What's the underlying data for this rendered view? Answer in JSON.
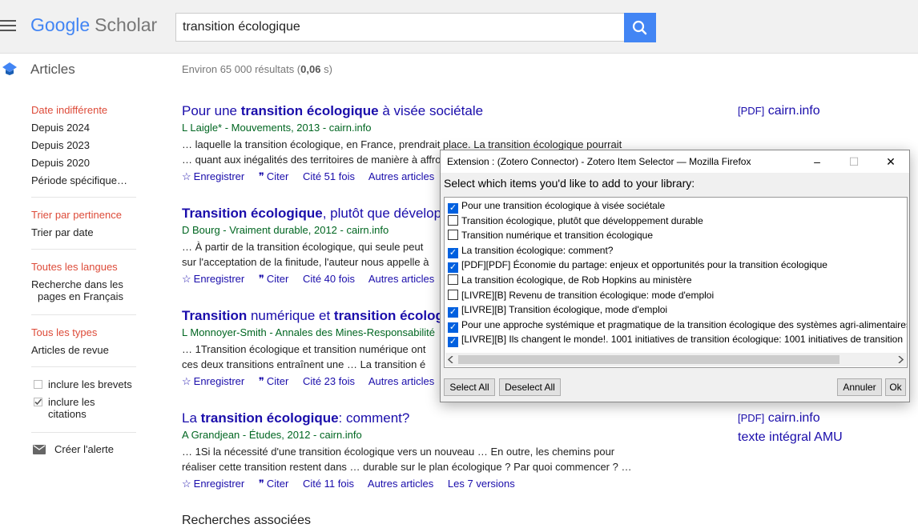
{
  "header": {
    "logo_google": "Google",
    "logo_scholar": "Scholar",
    "search_value": "transition écologique"
  },
  "subheader": {
    "articles": "Articles",
    "results_prefix": "Environ 65 000 résultats (",
    "results_time": "0,06",
    "results_suffix": " s)"
  },
  "sidebar": {
    "date_any": "Date indifférente",
    "since_2024": "Depuis 2024",
    "since_2023": "Depuis 2023",
    "since_2020": "Depuis 2020",
    "period": "Période spécifique…",
    "sort_relevance": "Trier par pertinence",
    "sort_date": "Trier par date",
    "all_languages": "Toutes les langues",
    "search_french_1": "Recherche dans les",
    "search_french_2": "pages en Français",
    "all_types": "Tous les types",
    "review_articles": "Articles de revue",
    "include_patents": "inclure les brevets",
    "include_citations_1": "inclure les",
    "include_citations_2": "citations",
    "create_alert": "Créer l'alerte"
  },
  "results": [
    {
      "title_parts": [
        "Pour une ",
        "transition écologique",
        " à visée sociétale"
      ],
      "meta": "L Laigle* - Mouvements, 2013 - cairn.info",
      "snippet1": "… laquelle la transition écologique, en France, prendrait place. La transition écologique pourrait",
      "snippet2": "… quant aux inégalités des territoires de manière à affro",
      "save": "Enregistrer",
      "cite": "Citer",
      "cited": "Cité 51 fois",
      "related": "Autres articles",
      "side_tag": "[PDF]",
      "side_link": "cairn.info"
    },
    {
      "title_parts": [
        "Transition écologique",
        ", plutôt que dévelop",
        ""
      ],
      "meta": "D Bourg - Vraiment durable, 2012 - cairn.info",
      "snippet1": "… À partir de la transition écologique, qui seule peut",
      "snippet2": "sur l'acceptation de la finitude, l'auteur nous appelle à",
      "save": "Enregistrer",
      "cite": "Citer",
      "cited": "Cité 40 fois",
      "related": "Autres articles"
    },
    {
      "title_parts": [
        "Transition",
        " numérique et ",
        "transition écolog"
      ],
      "meta": "L Monnoyer-Smith - Annales des Mines-Responsabilité",
      "snippet1": "… 1Transition écologique et transition numérique ont",
      "snippet2": "ces deux transitions entraînent une … La transition é",
      "save": "Enregistrer",
      "cite": "Citer",
      "cited": "Cité 23 fois",
      "related": "Autres articles"
    },
    {
      "title_parts": [
        "La ",
        "transition écologique",
        ": comment?"
      ],
      "meta": "A Grandjean - Études, 2012 - cairn.info",
      "snippet1": "… 1Si la nécessité d'une transition écologique vers un nouveau … En outre, les chemins pour",
      "snippet2": "réaliser cette transition restent dans … durable sur le plan écologique ? Par quoi commencer ? …",
      "save": "Enregistrer",
      "cite": "Citer",
      "cited": "Cité 11 fois",
      "related": "Autres articles",
      "versions": "Les 7 versions",
      "side_tag": "[PDF]",
      "side_link": "cairn.info",
      "side_link2": "texte intégral AMU"
    }
  ],
  "related_searches": "Recherches associées",
  "dialog": {
    "title": "Extension : (Zotero Connector) - Zotero Item Selector — Mozilla Firefox",
    "minimize": "–",
    "maximize": "☐",
    "close": "✕",
    "prompt": "Select which items you'd like to add to your library:",
    "items": [
      {
        "label": "Pour une transition écologique à visée sociétale",
        "checked": true
      },
      {
        "label": "Transition écologique, plutôt que développement durable",
        "checked": false
      },
      {
        "label": "Transition numérique et transition écologique",
        "checked": false
      },
      {
        "label": "La transition écologique: comment?",
        "checked": true
      },
      {
        "label": "[PDF][PDF] Économie du partage: enjeux et opportunités pour la transition écologique",
        "checked": true
      },
      {
        "label": "La transition écologique, de Rob Hopkins au ministère",
        "checked": false
      },
      {
        "label": "[LIVRE][B] Revenu de transition écologique: mode d'emploi",
        "checked": false
      },
      {
        "label": "[LIVRE][B] Transition écologique, mode d'emploi",
        "checked": true
      },
      {
        "label": "Pour une approche systémique et pragmatique de la transition écologique des systèmes agri-alimentaires",
        "checked": true
      },
      {
        "label": "[LIVRE][B] Ils changent le monde!. 1001 initiatives de transition écologique: 1001 initiatives de transition",
        "checked": true
      }
    ],
    "select_all": "Select All",
    "deselect_all": "Deselect All",
    "cancel": "Annuler",
    "ok": "Ok"
  }
}
